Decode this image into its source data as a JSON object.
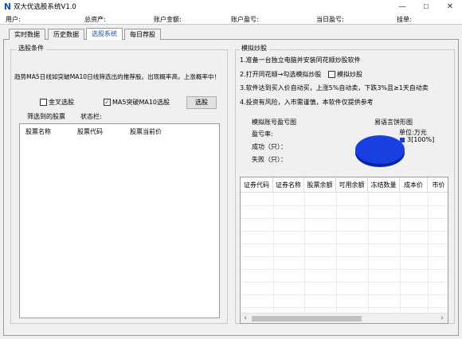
{
  "window": {
    "title": "双大优选股系统V1.0",
    "min_glyph": "—",
    "max_glyph": "☐",
    "close_glyph": "✕"
  },
  "info_bar": {
    "user": "用户:",
    "total_assets": "总资产:",
    "account_amount": "账户金额:",
    "account_pnl": "账户盈亏:",
    "today_pnl": "当日盈亏:",
    "pending": "挂单:"
  },
  "tabs": [
    {
      "label": "实时数据",
      "active": false
    },
    {
      "label": "历史数据",
      "active": false
    },
    {
      "label": "选股系统",
      "active": true
    },
    {
      "label": "每日荐股",
      "active": false
    }
  ],
  "left": {
    "group_title": "选股条件",
    "description": "趋势MA5日线如突破MA10日线筛选出的推荐股。出现概率高，上涨概率中！",
    "checkbox_golden": {
      "label": "金叉选股",
      "checked": false,
      "mark": "✓"
    },
    "checkbox_ma": {
      "label": "MA5突破MA10选股",
      "checked": true,
      "mark": "✓"
    },
    "select_button": "选股",
    "filtered_label": "筛选到的股票",
    "status_label": "状态栏:",
    "list_columns": [
      "股票名称",
      "股票代码",
      "股票当前价"
    ]
  },
  "right": {
    "group_title": "模拟炒股",
    "steps": [
      "1.准备一台独立电脑并安装同花顺炒股软件",
      "2.打开同花顺→勾选模拟炒股",
      "3.软件达到买入价自动买，上涨5%自动卖，下跌3%且≥1天自动卖",
      "4.投资有风险，入市需谨慎，本软件仅提供参考"
    ],
    "sim_checkbox": {
      "label": "模拟炒股",
      "checked": false
    },
    "stats": {
      "title": "模拟账号盈亏图",
      "rate_label": "盈亏率:",
      "success_label": "成功（只）：",
      "fail_label": "失败（只）："
    },
    "pie": {
      "title": "易语言饼形图",
      "unit": "单位:万元",
      "legend_label": "3[100%]",
      "color": "#1a3fe0",
      "slices": [
        {
          "label": "3[100%]",
          "value": 3,
          "percent": 100
        }
      ]
    },
    "grid_columns": [
      "证券代码",
      "证券名称",
      "股票余额",
      "可用余额",
      "冻结数量",
      "成本价",
      "市价"
    ],
    "scroll_left": "‹",
    "scroll_right": "›"
  }
}
